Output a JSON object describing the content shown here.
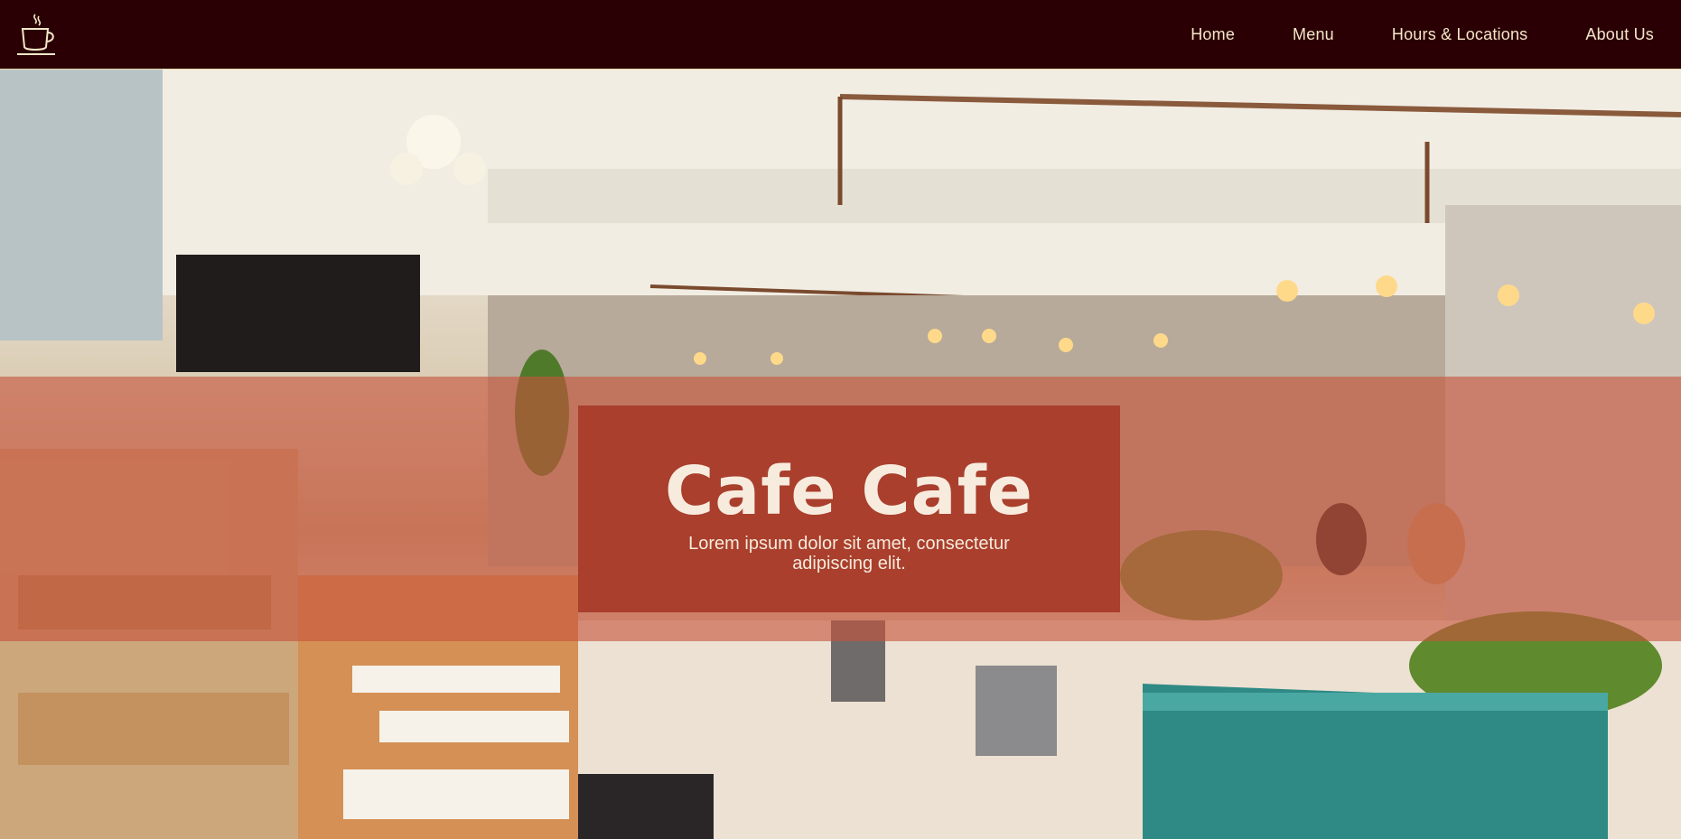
{
  "header": {
    "logo_icon": "coffee-cup-icon",
    "nav": [
      {
        "label": "Home"
      },
      {
        "label": "Menu"
      },
      {
        "label": "Hours & Locations"
      },
      {
        "label": "About Us"
      }
    ]
  },
  "hero": {
    "background_image": "cafe-interior-photo",
    "title": "Cafe Cafe",
    "subtitle": "Lorem ipsum dolor sit amet, consectetur adipiscing elit."
  },
  "colors": {
    "header_bg": "#2a0004",
    "nav_text": "#f4e6c8",
    "band_overlay": "#c6543c",
    "card_bg": "#a93f2c",
    "card_text": "#f6eadd"
  }
}
